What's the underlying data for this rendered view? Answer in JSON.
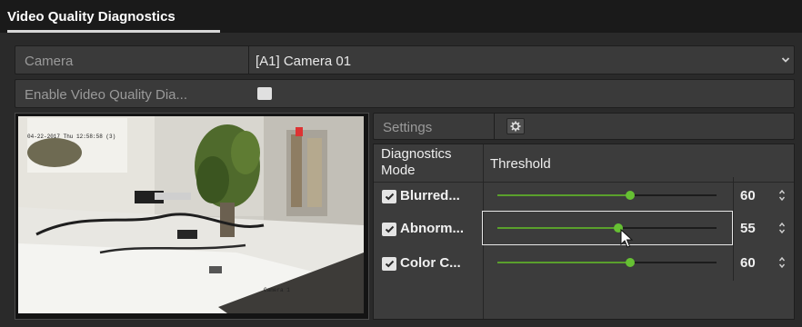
{
  "header": {
    "title": "Video Quality Diagnostics"
  },
  "camera": {
    "label": "Camera",
    "value": "[A1] Camera 01"
  },
  "enable": {
    "label": "Enable Video Quality Dia...",
    "checked": false
  },
  "preview": {
    "osd_timestamp": "04-22-2017 Thu 12:58:58 (3)",
    "osd_camera_name": "Camera 1"
  },
  "settings": {
    "label": "Settings",
    "icon": "gear-icon"
  },
  "table": {
    "col_mode": "Diagnostics Mode",
    "col_threshold": "Threshold",
    "rows": [
      {
        "label": "Blurred...",
        "checked": true,
        "value": 60
      },
      {
        "label": "Abnorm...",
        "checked": true,
        "value": 55
      },
      {
        "label": "Color C...",
        "checked": true,
        "value": 60
      }
    ]
  },
  "colors": {
    "accent": "#5aa02c",
    "background": "#2a2a2a",
    "panel": "#3a3a3a"
  }
}
